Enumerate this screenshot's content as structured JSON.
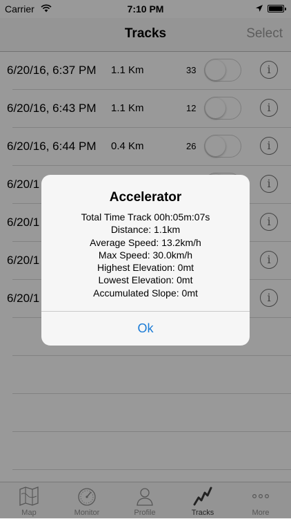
{
  "status_bar": {
    "carrier": "Carrier",
    "time": "7:10 PM"
  },
  "nav": {
    "title": "Tracks",
    "select_label": "Select"
  },
  "tracks": [
    {
      "date": "6/20/16, 6:37 PM",
      "distance": "1.1 Km",
      "count": "33"
    },
    {
      "date": "6/20/16, 6:43 PM",
      "distance": "1.1 Km",
      "count": "12"
    },
    {
      "date": "6/20/16, 6:44 PM",
      "distance": "0.4 Km",
      "count": "26"
    },
    {
      "date": "6/20/1",
      "distance": "",
      "count": ""
    },
    {
      "date": "6/20/1",
      "distance": "",
      "count": ""
    },
    {
      "date": "6/20/1",
      "distance": "",
      "count": ""
    },
    {
      "date": "6/20/1",
      "distance": "",
      "count": ""
    }
  ],
  "info_glyph": "i",
  "alert": {
    "title": "Accelerator",
    "lines": [
      "Total Time Track 00h:05m:07s",
      "Distance: 1.1km",
      "Average Speed: 13.2km/h",
      "Max Speed: 30.0km/h",
      "Highest Elevation: 0mt",
      "Lowest Elevation: 0mt",
      "Accumulated Slope: 0mt"
    ],
    "ok_label": "Ok"
  },
  "tabs": [
    {
      "label": "Map",
      "icon": "map-icon"
    },
    {
      "label": "Monitor",
      "icon": "speedometer-icon"
    },
    {
      "label": "Profile",
      "icon": "profile-icon"
    },
    {
      "label": "Tracks",
      "icon": "tracks-icon"
    },
    {
      "label": "More",
      "icon": "more-icon"
    }
  ],
  "colors": {
    "accent": "#1a7bd6",
    "overlay": "#000000",
    "select_disabled": "#9a9a9a"
  }
}
